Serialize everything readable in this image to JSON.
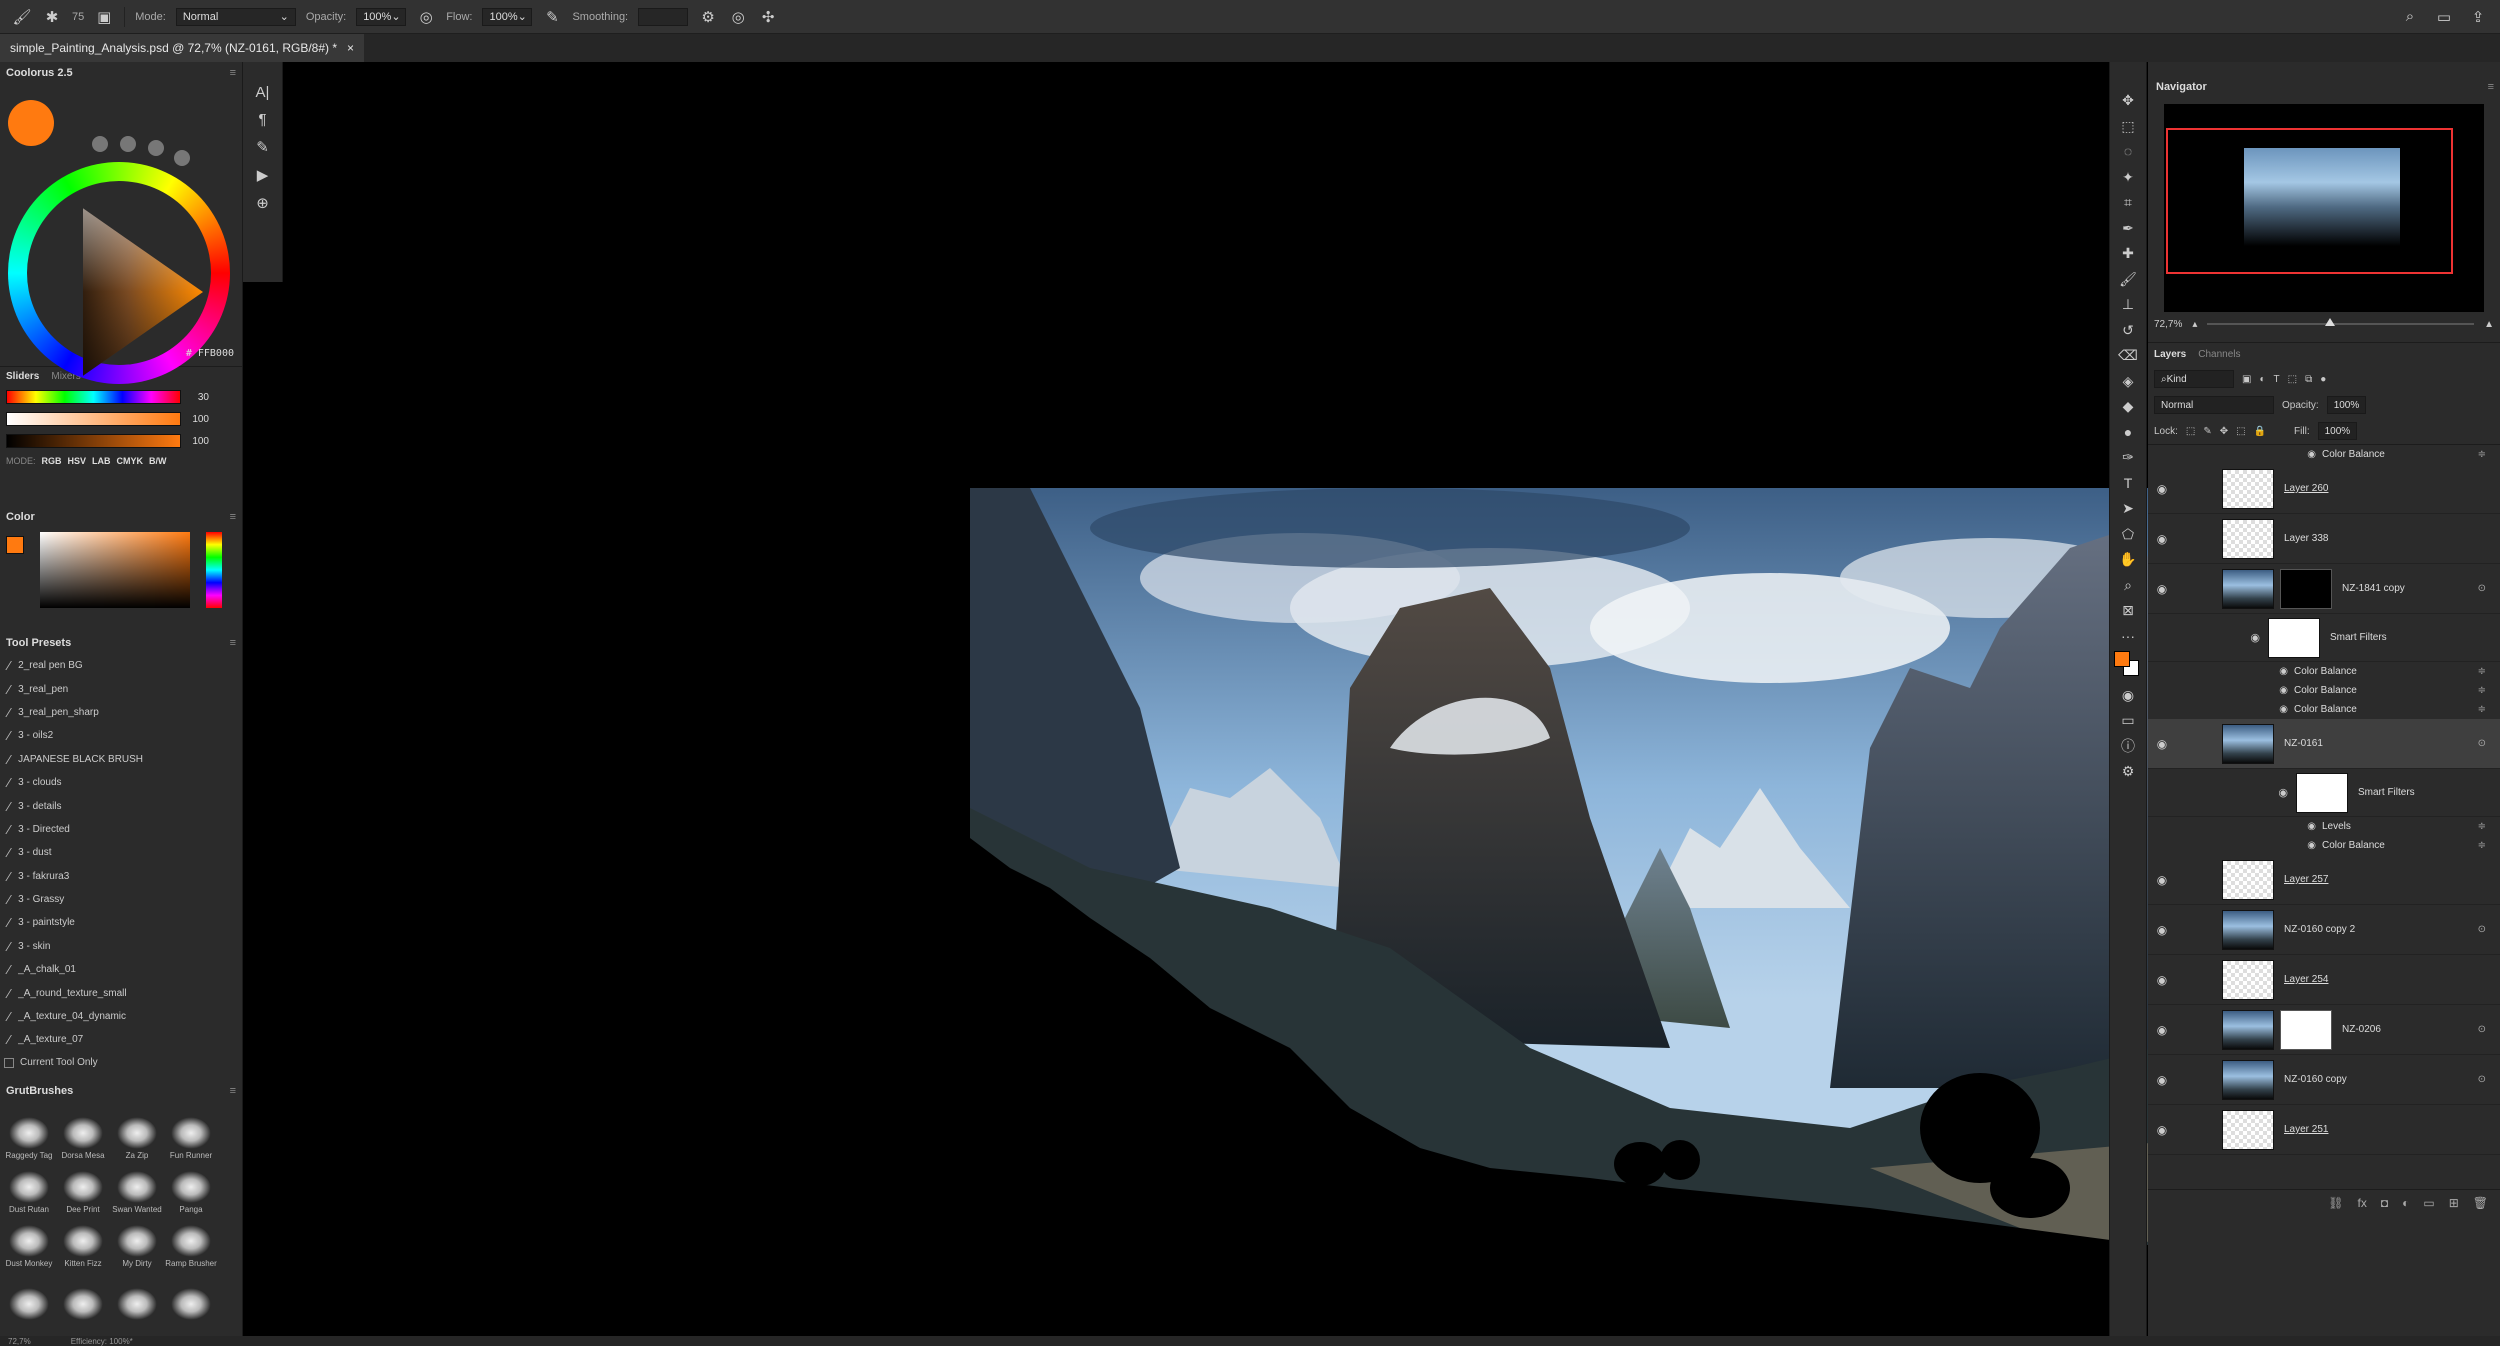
{
  "options_bar": {
    "mode_label": "Mode:",
    "mode_value": "Normal",
    "opacity_label": "Opacity:",
    "opacity_value": "100%",
    "flow_label": "Flow:",
    "flow_value": "100%",
    "smoothing_label": "Smoothing:",
    "brush_size": "75"
  },
  "document_tab": {
    "title": "simple_Painting_Analysis.psd @ 72,7% (NZ-0161, RGB/8#) *",
    "close": "×"
  },
  "coolorus": {
    "title": "Coolorus 2.5",
    "hex": "# FFB000",
    "tabs": [
      "Sliders",
      "Mixers"
    ],
    "slider_values": [
      "30",
      "100",
      "100"
    ],
    "mode_label": "MODE:",
    "modes": [
      "RGB",
      "HSV",
      "LAB",
      "CMYK",
      "B/W"
    ]
  },
  "color_panel": {
    "title": "Color"
  },
  "tool_presets": {
    "title": "Tool Presets",
    "items": [
      "2_real pen BG",
      "3_real_pen",
      "3_real_pen_sharp",
      "3 - oils2",
      "JAPANESE BLACK BRUSH",
      "3 - clouds",
      "3 - details",
      "3 - Directed",
      "3 - dust",
      "3 - fakrura3",
      "3 - Grassy",
      "3 - paintstyle",
      "3 - skin",
      "_A_chalk_01",
      "_A_round_texture_small",
      "_A_texture_04_dynamic",
      "_A_texture_07"
    ],
    "current_tool_only": "Current Tool Only"
  },
  "grut_brushes": {
    "title": "GrutBrushes",
    "items": [
      "Raggedy Tag",
      "Dorsa Mesa",
      "Za Zip",
      "Fun Runner",
      "Dust Rutan",
      "Dee Print",
      "Swan Wanted",
      "Panga",
      "Dust Monkey",
      "Kitten Fizz",
      "My Dirty",
      "Ramp Brusher",
      "",
      "",
      "",
      ""
    ]
  },
  "navigator": {
    "title": "Navigator",
    "zoom": "72,7%"
  },
  "layers_panel": {
    "tabs": [
      "Layers",
      "Channels"
    ],
    "filter_kind": "Kind",
    "blend_mode": "Normal",
    "opacity_label": "Opacity:",
    "opacity_value": "100%",
    "lock_label": "Lock:",
    "fill_label": "Fill:",
    "fill_value": "100%",
    "rows": [
      {
        "type": "sub",
        "name": "Color Balance",
        "indent": 1
      },
      {
        "type": "layer",
        "name": "Layer 260",
        "thumb": "trans",
        "underline": true
      },
      {
        "type": "layer",
        "name": "Layer 338",
        "thumb": "trans",
        "underline": false
      },
      {
        "type": "layer",
        "name": "NZ-1841 copy",
        "thumb": "img",
        "mask": "black"
      },
      {
        "type": "smart",
        "name": "Smart Filters",
        "indent": 1
      },
      {
        "type": "sub",
        "name": "Color Balance",
        "indent": 0
      },
      {
        "type": "sub",
        "name": "Color Balance",
        "indent": 0
      },
      {
        "type": "sub",
        "name": "Color Balance",
        "indent": 0
      },
      {
        "type": "layer",
        "name": "NZ-0161",
        "thumb": "img",
        "selected": true
      },
      {
        "type": "smart",
        "name": "Smart Filters",
        "indent": 2
      },
      {
        "type": "sub",
        "name": "Levels",
        "indent": 1
      },
      {
        "type": "sub",
        "name": "Color Balance",
        "indent": 1
      },
      {
        "type": "layer",
        "name": "Layer 257",
        "thumb": "trans",
        "underline": true
      },
      {
        "type": "layer",
        "name": "NZ-0160 copy 2",
        "thumb": "img"
      },
      {
        "type": "layer",
        "name": "Layer 254",
        "thumb": "trans",
        "underline": true
      },
      {
        "type": "layer",
        "name": "NZ-0206",
        "thumb": "img",
        "mask": "white"
      },
      {
        "type": "layer",
        "name": "NZ-0160 copy",
        "thumb": "img"
      },
      {
        "type": "layer",
        "name": "Layer 251",
        "thumb": "trans",
        "underline": true
      }
    ]
  },
  "status": {
    "zoom": "72,7%",
    "efficiency": "Efficiency: 100%*"
  },
  "colors": {
    "foreground": "#ff7a10",
    "accent_red": "#e33333"
  }
}
